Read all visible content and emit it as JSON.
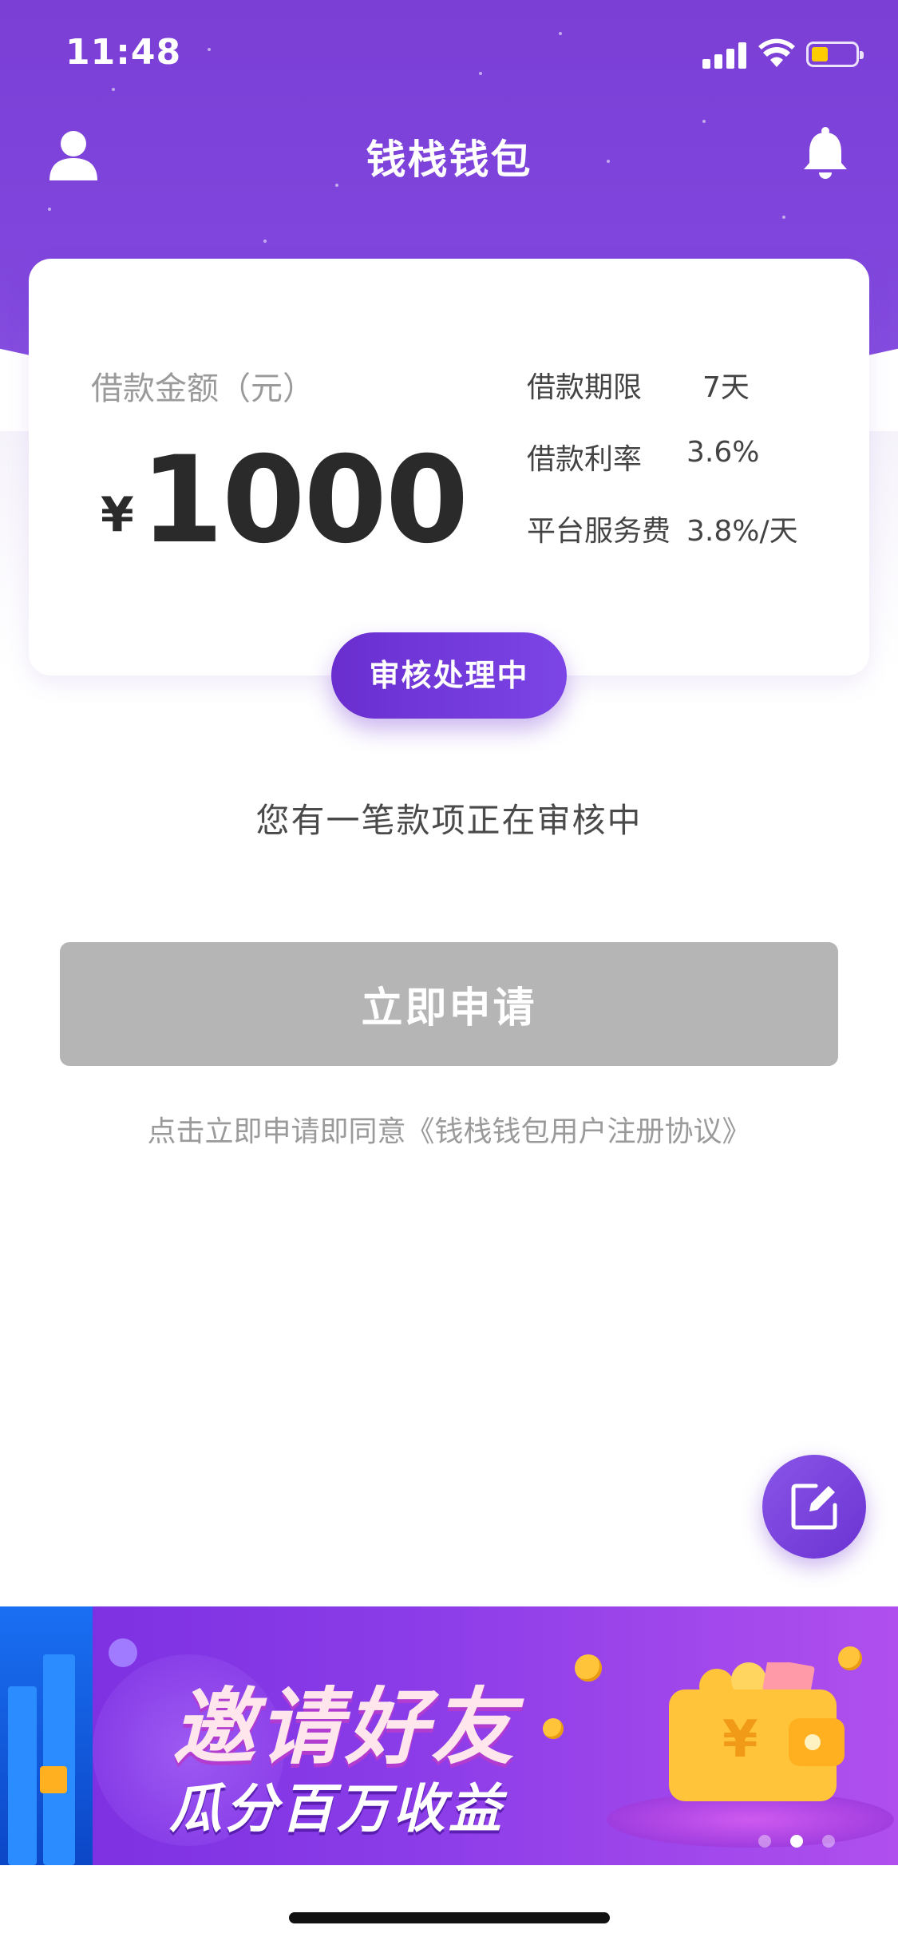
{
  "status_bar": {
    "time": "11:48"
  },
  "nav": {
    "title": "钱栈钱包"
  },
  "loan_card": {
    "amount_label": "借款金额（元）",
    "currency_symbol": "¥",
    "amount": "1000",
    "terms": [
      {
        "label": "借款期限",
        "value": "7天"
      },
      {
        "label": "借款利率",
        "value": "3.6%"
      },
      {
        "label": "平台服务费",
        "value": "3.8%/天"
      }
    ],
    "status": "审核处理中"
  },
  "review_message": "您有一笔款项正在审核中",
  "apply_button": {
    "label": "立即申请"
  },
  "agreement_text": "点击立即申请即同意《钱栈钱包用户注册协议》",
  "banner": {
    "title": "邀请好友",
    "subtitle": "瓜分百万收益",
    "wallet_symbol": "¥",
    "page_count": 3,
    "active_page": 2
  },
  "icons": {
    "profile": "user-icon",
    "notifications": "bell-icon",
    "fab": "edit-icon"
  },
  "colors": {
    "primary": "#7b3fd6",
    "button_disabled": "#b5b5b5",
    "battery": "#ffcc00"
  }
}
